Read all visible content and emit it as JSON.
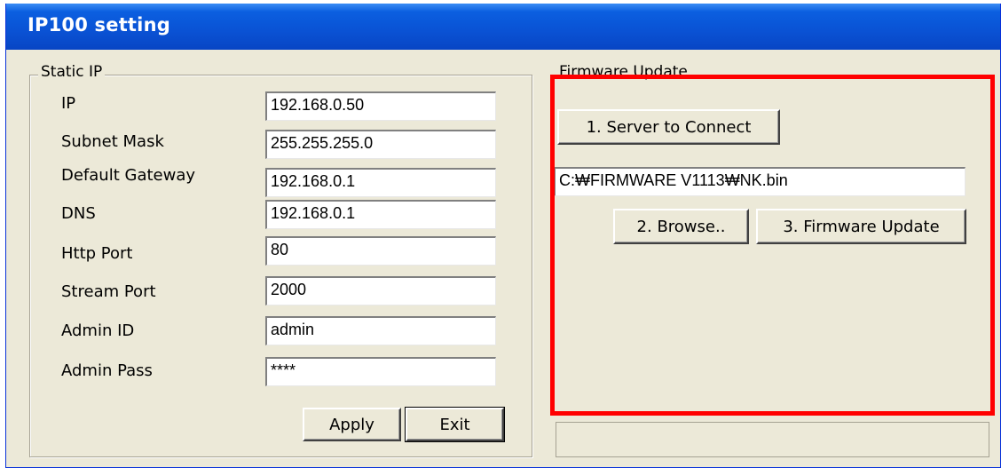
{
  "window": {
    "title": "IP100 setting"
  },
  "static_ip": {
    "legend": "Static IP",
    "fields": [
      {
        "label": "IP",
        "value": "192.168.0.50"
      },
      {
        "label": "Subnet Mask",
        "value": "255.255.255.0"
      },
      {
        "label": "Default Gateway",
        "value": "192.168.0.1"
      },
      {
        "label": "DNS",
        "value": "192.168.0.1"
      },
      {
        "label": "Http Port",
        "value": "80"
      },
      {
        "label": "Stream Port",
        "value": "2000"
      },
      {
        "label": "Admin ID",
        "value": "admin"
      },
      {
        "label": "Admin Pass",
        "value": "****"
      }
    ],
    "apply_label": "Apply",
    "exit_label": "Exit"
  },
  "firmware": {
    "legend": "Firmware Update",
    "server_button": "1. Server to Connect",
    "path_value": "C:₩FIRMWARE V1113₩NK.bin",
    "browse_button": "2. Browse..",
    "update_button": "3. Firmware Update"
  },
  "colors": {
    "title_bar": "#0a52d4",
    "window_bg": "#ece9d8",
    "highlight_box": "#ff0000"
  }
}
